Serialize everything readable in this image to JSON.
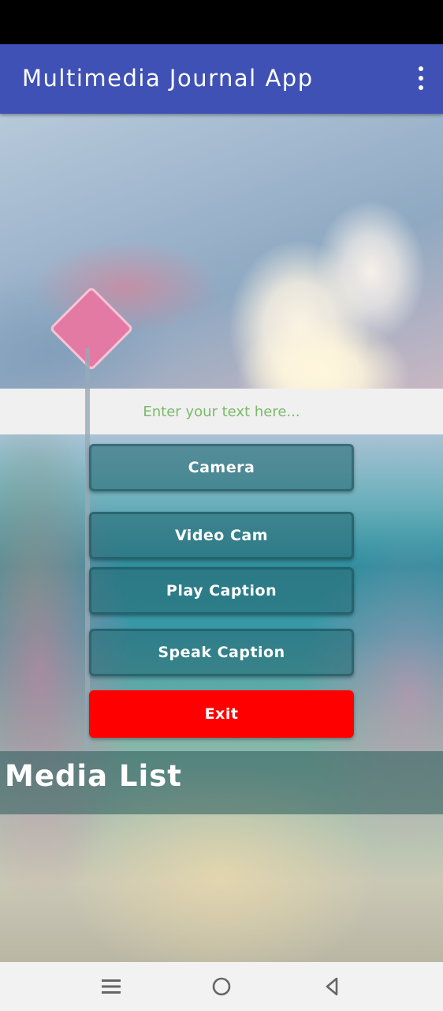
{
  "app": {
    "title": "Multimedia Journal App",
    "overflow_icon": "more-vert-icon"
  },
  "caption_input": {
    "placeholder": "Enter your text here...",
    "value": ""
  },
  "buttons": {
    "camera": "Camera",
    "video_cam": "Video Cam",
    "play_caption": "Play Caption",
    "speak_caption": "Speak Caption",
    "exit": "Exit"
  },
  "media_list": {
    "title": "Media List"
  },
  "nav": {
    "menu_icon": "recent-apps-icon",
    "home_icon": "home-icon",
    "back_icon": "back-icon"
  },
  "colors": {
    "app_bar": "#3f51b5",
    "placeholder": "#7cb96a",
    "exit_button": "#ff0000"
  }
}
